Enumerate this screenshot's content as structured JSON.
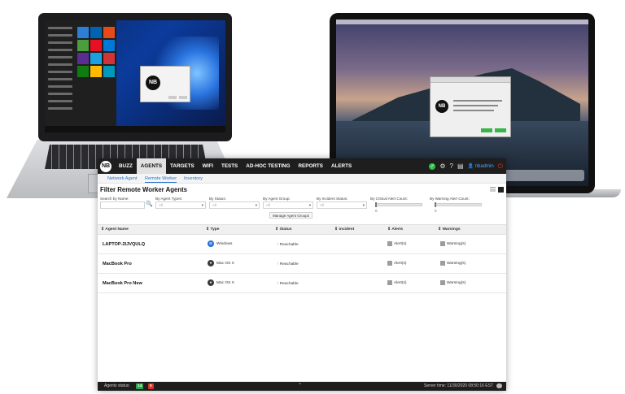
{
  "app": {
    "logo": "NB",
    "nav": [
      "BUZZ",
      "AGENTS",
      "TARGETS",
      "WIFI",
      "TESTS",
      "AD-HOC TESTING",
      "REPORTS",
      "ALERTS"
    ],
    "nav_active": "AGENTS",
    "user": "nbadmin",
    "subnav": [
      "Network Agent",
      "Remote Worker",
      "Inventory"
    ],
    "subnav_active": "Remote Worker",
    "filter_title": "Filter Remote Worker Agents",
    "filters": {
      "search_label": "Search by Name:",
      "agent_types_label": "By Agent Types:",
      "status_label": "By Status:",
      "agent_group_label": "By Agent Group:",
      "incident_label": "By Incident Status:",
      "critical_label": "By Critical Alert Count:",
      "warning_label": "By Warning Alert Count:",
      "select_placeholder": "All",
      "critical_value": "0",
      "warning_value": "0",
      "manage_groups": "Manage Agent Groups"
    },
    "table": {
      "columns": [
        "Agent Name",
        "Type",
        "Status",
        "Incident",
        "Alerts",
        "Warnings"
      ],
      "rows": [
        {
          "name": "LAPTOP-2IJVQULQ",
          "type": "Windows",
          "os": "windows-logo-icon",
          "status": "Reachable",
          "incident": "",
          "alerts": "Alert(s)",
          "warnings": "Warning(s)"
        },
        {
          "name": "MacBook Pro",
          "type": "Mac OS X",
          "os": "apple-logo-icon",
          "status": "Reachable",
          "incident": "",
          "alerts": "Alert(s)",
          "warnings": "Warning(s)"
        },
        {
          "name": "MacBook Pro New",
          "type": "Mac OS X",
          "os": "apple-logo-icon",
          "status": "Reachable",
          "incident": "",
          "alerts": "Alert(s)",
          "warnings": "Warning(s)"
        }
      ]
    },
    "footer": {
      "agents_status_label": "Agents status:",
      "green_count": "14",
      "red_count": "0",
      "server_time": "Server time: 11/30/2020 08:50:16 EST"
    },
    "colors": {
      "navbar": "#1e1e1e",
      "accent_blue": "#2a73c8",
      "status_green": "#2ca84a",
      "status_red": "#d9342b"
    }
  },
  "background_laptops": {
    "windows_dialog_logo": "NB",
    "mac_dialog_logo": "NB"
  }
}
